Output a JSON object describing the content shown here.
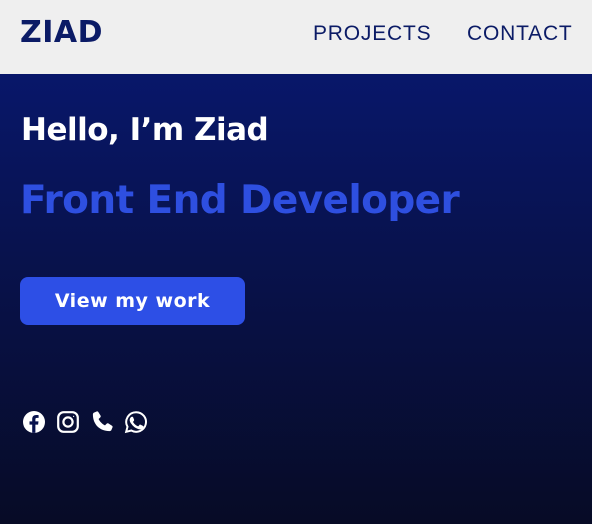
{
  "header": {
    "logo": "ZIAD",
    "nav": [
      {
        "label": "PROJECTS"
      },
      {
        "label": "CONTACT"
      }
    ]
  },
  "hero": {
    "greeting": "Hello, I’m Ziad",
    "role": "Front End Developer",
    "cta_label": "View my work"
  },
  "socials": [
    {
      "icon": "facebook-icon"
    },
    {
      "icon": "instagram-icon"
    },
    {
      "icon": "phone-icon"
    },
    {
      "icon": "whatsapp-icon"
    }
  ],
  "colors": {
    "header_bg": "#efefef",
    "brand_navy": "#0b1b66",
    "accent_blue": "#2d4fe6",
    "hero_top": "#08176a",
    "hero_bottom": "#070b26"
  }
}
